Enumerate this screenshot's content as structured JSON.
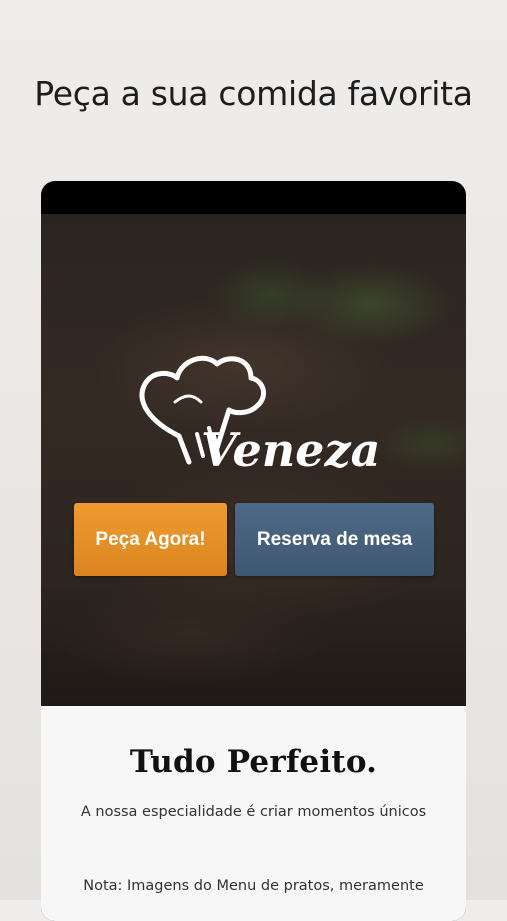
{
  "headline": "Peça a sua comida favorita",
  "app": {
    "brand": "Veneza",
    "buttons": {
      "order_label": "Peça Agora!",
      "reserve_label": "Reserva de mesa"
    },
    "section": {
      "title": "Tudo Perfeito.",
      "tagline": "A nossa especialidade é criar momentos únicos",
      "note": "Nota: Imagens do Menu de pratos, meramente"
    }
  },
  "colors": {
    "order_button": "#e68f26",
    "reserve_button": "#465f7b",
    "background": "#ece9e6"
  }
}
